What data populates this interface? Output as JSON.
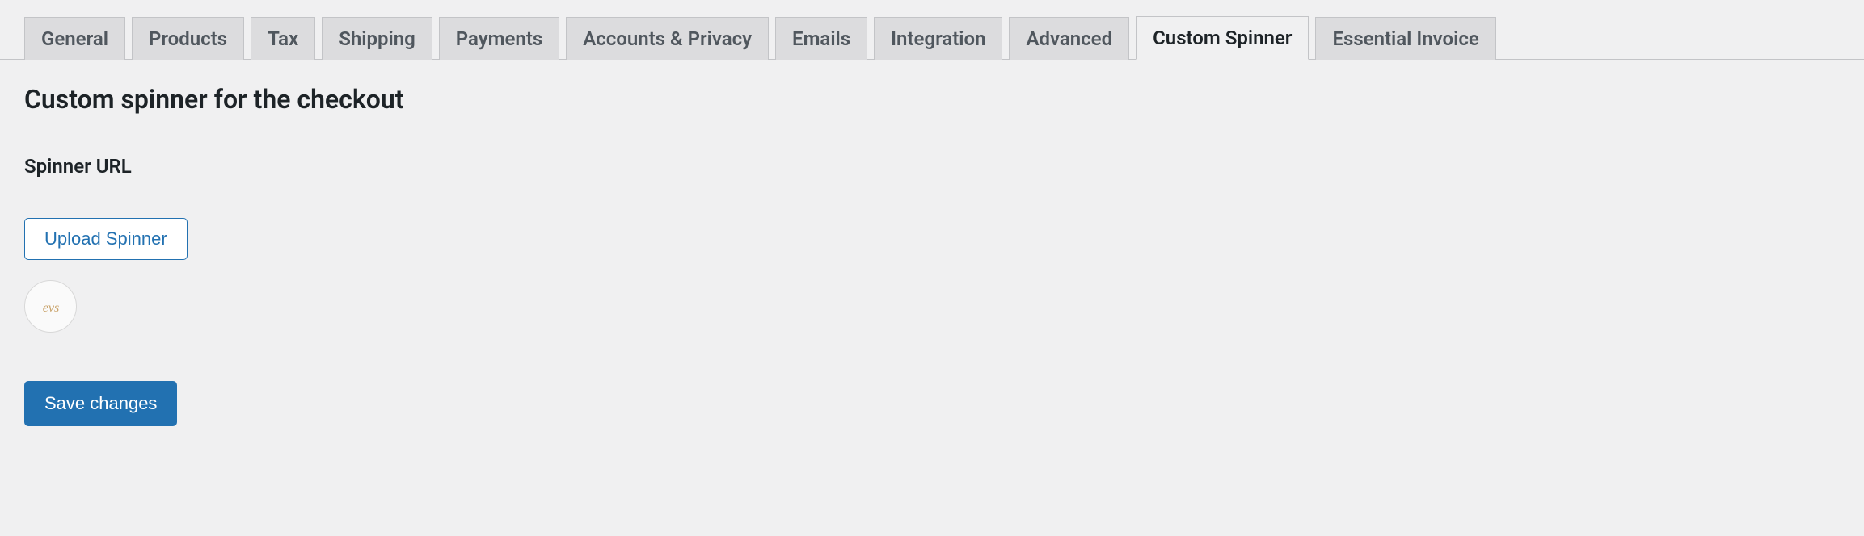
{
  "tabs": [
    {
      "label": "General",
      "active": false
    },
    {
      "label": "Products",
      "active": false
    },
    {
      "label": "Tax",
      "active": false
    },
    {
      "label": "Shipping",
      "active": false
    },
    {
      "label": "Payments",
      "active": false
    },
    {
      "label": "Accounts & Privacy",
      "active": false
    },
    {
      "label": "Emails",
      "active": false
    },
    {
      "label": "Integration",
      "active": false
    },
    {
      "label": "Advanced",
      "active": false
    },
    {
      "label": "Custom Spinner",
      "active": true
    },
    {
      "label": "Essential Invoice",
      "active": false
    }
  ],
  "page": {
    "title": "Custom spinner for the checkout"
  },
  "field": {
    "label": "Spinner URL"
  },
  "buttons": {
    "upload": "Upload Spinner",
    "save": "Save changes"
  }
}
